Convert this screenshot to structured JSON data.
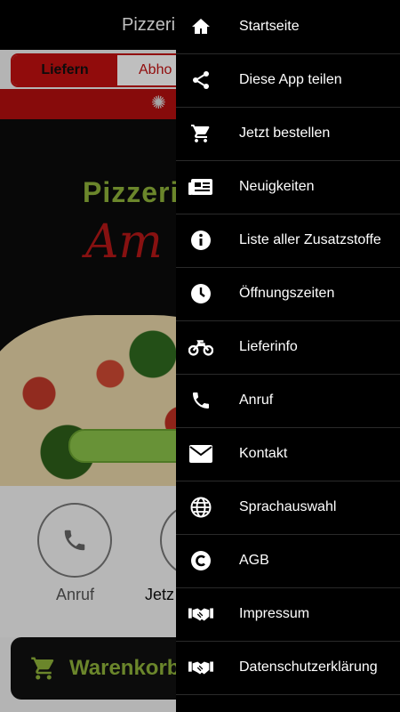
{
  "topbar": {
    "title": "Pizzeria"
  },
  "order_mode": {
    "option1": "Liefern",
    "option2": "Abho"
  },
  "hero": {
    "brand_line1": "Pizzeri",
    "brand_line2": "Am"
  },
  "quick_actions": {
    "call_label": "Anruf",
    "order_label": "Jetz"
  },
  "cart": {
    "label": "Warenkorb"
  },
  "drawer": {
    "items": [
      {
        "label": "Startseite",
        "icon": "home-icon"
      },
      {
        "label": "Diese App teilen",
        "icon": "share-icon"
      },
      {
        "label": "Jetzt bestellen",
        "icon": "cart-icon"
      },
      {
        "label": "Neuigkeiten",
        "icon": "news-icon"
      },
      {
        "label": "Liste aller Zusatzstoffe",
        "icon": "info-icon"
      },
      {
        "label": "Öffnungszeiten",
        "icon": "clock-icon"
      },
      {
        "label": "Lieferinfo",
        "icon": "motorcycle-icon"
      },
      {
        "label": "Anruf",
        "icon": "phone-icon"
      },
      {
        "label": "Kontakt",
        "icon": "envelope-icon"
      },
      {
        "label": "Sprachauswahl",
        "icon": "globe-icon"
      },
      {
        "label": "AGB",
        "icon": "copyright-icon"
      },
      {
        "label": "Impressum",
        "icon": "handshake-icon"
      },
      {
        "label": "Datenschutzerklärung",
        "icon": "handshake-icon"
      }
    ]
  },
  "colors": {
    "brand_red": "#b50f0f",
    "brand_green": "#8fb33a",
    "drawer_bg": "#000000"
  }
}
